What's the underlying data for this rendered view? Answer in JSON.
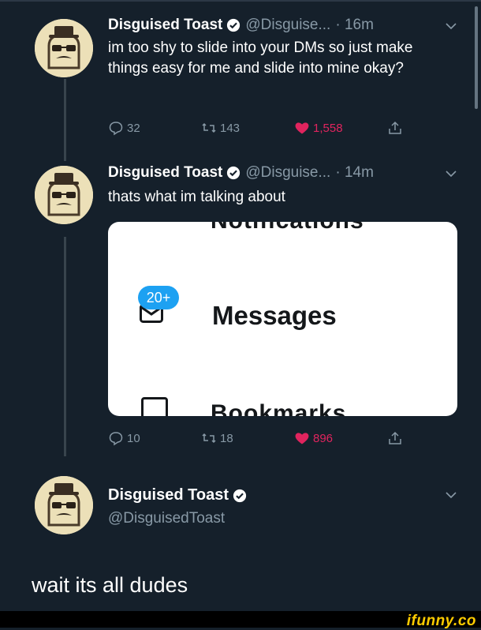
{
  "tweets": [
    {
      "name": "Disguised Toast",
      "handle": "@Disguise...",
      "time": "· 16m",
      "text": "im too shy to slide into your DMs so just make things easy for me and slide into mine okay?",
      "replies": "32",
      "retweets": "143",
      "likes": "1,558"
    },
    {
      "name": "Disguised Toast",
      "handle": "@Disguise...",
      "time": "· 14m",
      "text": "thats what im talking about",
      "replies": "10",
      "retweets": "18",
      "likes": "896"
    }
  ],
  "embed": {
    "top_cut_text": "Notifications",
    "badge": "20+",
    "messages_label": "Messages",
    "bottom_cut_text": "Bookmarks"
  },
  "reply_user": {
    "name": "Disguised Toast",
    "handle": "@DisguisedToast"
  },
  "caption": "wait its all dudes",
  "watermark": "ifunny.co",
  "colors": {
    "background": "#15202b",
    "like": "#e0245e",
    "muted": "#8899a6",
    "badge": "#1da1f2",
    "watermark": "#ffcc00"
  },
  "icons": [
    "reply-icon",
    "retweet-icon",
    "heart-icon",
    "share-icon",
    "verified-icon",
    "chevron-down-icon",
    "envelope-icon"
  ]
}
